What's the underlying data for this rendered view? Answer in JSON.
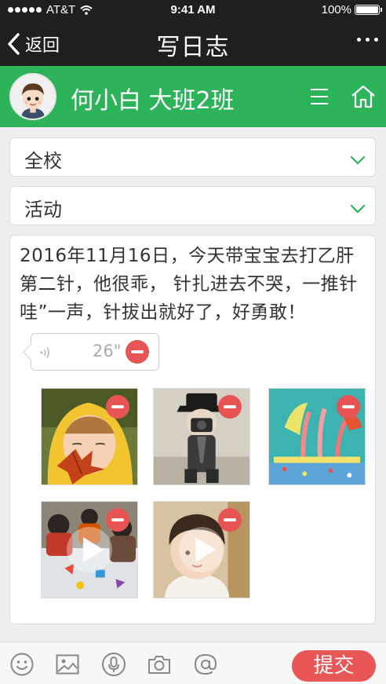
{
  "status_bar": {
    "carrier": "AT&T",
    "time": "9:41 AM",
    "battery": "100%"
  },
  "nav": {
    "back_label": "返回",
    "title": "写日志"
  },
  "profile": {
    "name": "何小白  大班2班"
  },
  "selects": [
    {
      "value": "全校"
    },
    {
      "value": "活动"
    }
  ],
  "diary": {
    "text": "2016年11月16日，今天带宝宝去打乙肝第二针，他很乖， 针扎进去不哭，一推针哇”一声，针拔出就好了，好勇敢！",
    "voice_duration": "26\""
  },
  "media": [
    {
      "type": "photo",
      "icon": "photo-icon"
    },
    {
      "type": "photo",
      "icon": "photo-icon"
    },
    {
      "type": "photo",
      "icon": "photo-icon"
    },
    {
      "type": "video",
      "icon": "play-icon"
    },
    {
      "type": "video",
      "icon": "play-icon"
    }
  ],
  "toolbar": {
    "icons": [
      "emoji-icon",
      "image-icon",
      "microphone-icon",
      "camera-icon",
      "at-icon"
    ],
    "submit_label": "提交"
  },
  "colors": {
    "brand_green": "#2db35a",
    "nav_dark": "#1f1f1f",
    "accent_red": "#e85454"
  }
}
